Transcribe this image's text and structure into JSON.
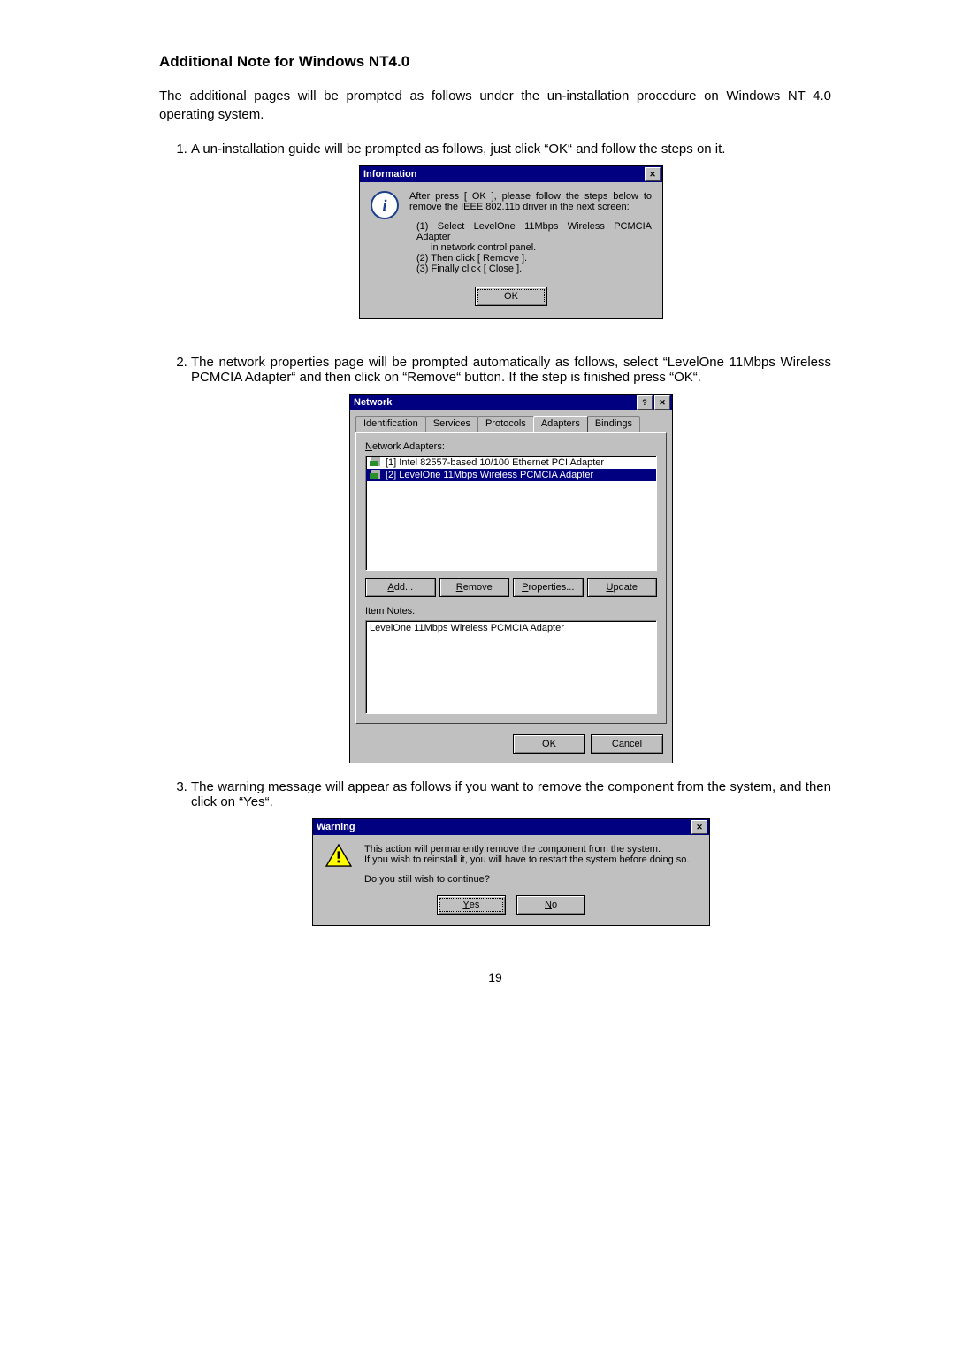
{
  "heading": "Additional Note for Windows NT4.0",
  "intro": "The additional pages will be prompted as follows under the un-installation procedure on Windows NT 4.0 operating system.",
  "steps": {
    "s1": "A un-installation guide will be prompted as follows, just click “OK“ and follow the steps on it.",
    "s2": "The network properties page will be prompted automatically as follows, select “LevelOne 11Mbps Wireless PCMCIA Adapter“ and then click on “Remove“ button. If the step is finished press “OK“.",
    "s3": "The warning message will appear as follows if you want to remove the component from the system, and then click on “Yes“."
  },
  "info_dialog": {
    "title": "Information",
    "line1": "After press [ OK ], please follow the steps below to remove the IEEE 802.11b driver in the next screen:",
    "sub1": "(1) Select LevelOne 11Mbps Wireless PCMCIA Adapter",
    "sub1b": "in network control panel.",
    "sub2": "(2) Then click [ Remove ].",
    "sub3": "(3) Finally click [ Close ].",
    "ok": "OK",
    "close_x": "✕"
  },
  "network_dialog": {
    "title": "Network",
    "help_q": "?",
    "close_x": "✕",
    "tabs": {
      "t0": "Identification",
      "t1": "Services",
      "t2": "Protocols",
      "t3": "Adapters",
      "t4": "Bindings"
    },
    "adapters_label": "Network Adapters:",
    "adapters_label_u": "N",
    "items": {
      "i0": "[1] Intel 82557-based 10/100 Ethernet PCI Adapter",
      "i1": "[2] LevelOne 11Mbps Wireless PCMCIA Adapter"
    },
    "buttons": {
      "add": "Add...",
      "add_u": "A",
      "remove": "Remove",
      "remove_u": "R",
      "properties": "Properties...",
      "properties_u": "P",
      "update": "Update",
      "update_u": "U"
    },
    "notes_label": "Item Notes:",
    "notes_value": "LevelOne 11Mbps Wireless PCMCIA Adapter",
    "ok": "OK",
    "cancel": "Cancel"
  },
  "warning_dialog": {
    "title": "Warning",
    "close_x": "✕",
    "line1": "This action will permanently remove the component from the system.",
    "line2": "If you wish to reinstall it, you will have to restart the system before doing so.",
    "line3": "Do you still wish to continue?",
    "yes": "Yes",
    "yes_u": "Y",
    "no": "No",
    "no_u": "N"
  },
  "page_number": "19"
}
